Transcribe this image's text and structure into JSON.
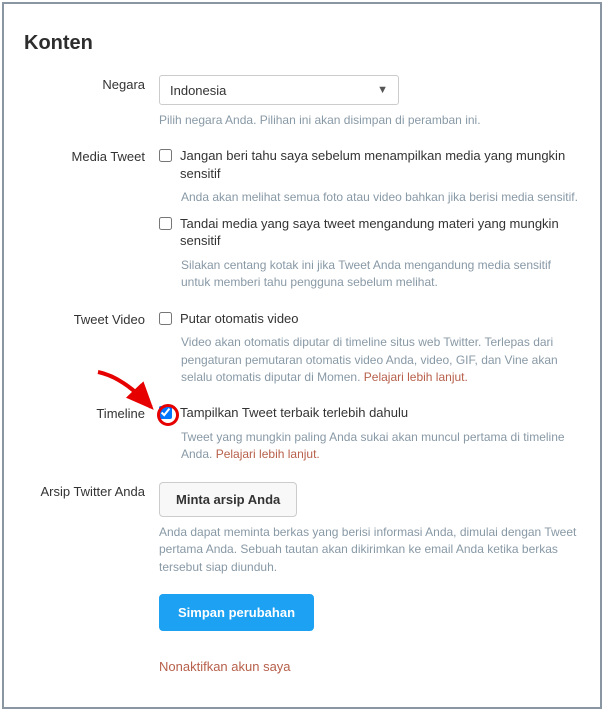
{
  "title": "Konten",
  "country": {
    "label": "Negara",
    "value": "Indonesia",
    "help": "Pilih negara Anda. Pilihan ini akan disimpan di peramban ini."
  },
  "media_tweet": {
    "label": "Media Tweet",
    "opt1": "Jangan beri tahu saya sebelum menampilkan media yang mungkin sensitif",
    "help1": "Anda akan melihat semua foto atau video bahkan jika berisi media sensitif.",
    "opt2": "Tandai media yang saya tweet mengandung materi yang mungkin sensitif",
    "help2": "Silakan centang kotak ini jika Tweet Anda mengandung media sensitif untuk memberi tahu pengguna sebelum melihat."
  },
  "tweet_video": {
    "label": "Tweet Video",
    "opt": "Putar otomatis video",
    "help_a": "Video akan otomatis diputar di timeline situs web Twitter. Terlepas dari pengaturan pemutaran otomatis video Anda, video, GIF, dan Vine akan selalu otomatis diputar di Momen. ",
    "learn": "Pelajari lebih lanjut."
  },
  "timeline": {
    "label": "Timeline",
    "opt": "Tampilkan Tweet terbaik terlebih dahulu",
    "help_a": "Tweet yang mungkin paling Anda sukai akan muncul pertama di timeline Anda. ",
    "learn": "Pelajari lebih lanjut."
  },
  "archive": {
    "label": "Arsip Twitter Anda",
    "button": "Minta arsip Anda",
    "help": "Anda dapat meminta berkas yang berisi informasi Anda, dimulai dengan Tweet pertama Anda. Sebuah tautan akan dikirimkan ke email Anda ketika berkas tersebut siap diunduh."
  },
  "save_button": "Simpan perubahan",
  "deactivate": "Nonaktifkan akun saya"
}
